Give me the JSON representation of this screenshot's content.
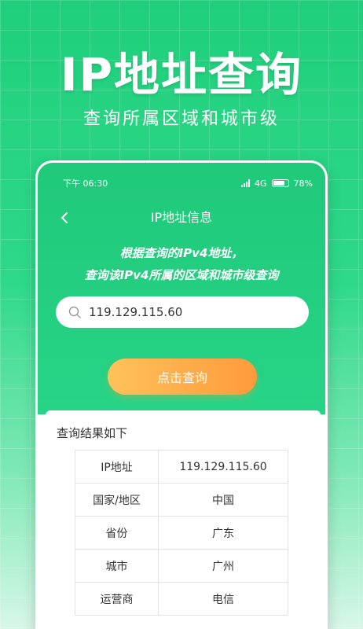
{
  "hero": {
    "title": "IP地址查询",
    "subtitle": "查询所属区域和城市级"
  },
  "status_bar": {
    "time": "下午 06:30",
    "network": "4G",
    "battery": "78%",
    "battery_level": 0.78
  },
  "nav": {
    "title": "IP地址信息"
  },
  "intro": {
    "line1": "根据查询的IPv4地址，",
    "line2": "查询该IPv4所属的区域和城市级查询"
  },
  "search": {
    "value": "119.129.115.60"
  },
  "query_button": {
    "label": "点击查询"
  },
  "result": {
    "title": "查询结果如下",
    "rows": [
      {
        "key": "IP地址",
        "value": "119.129.115.60"
      },
      {
        "key": "国家/地区",
        "value": "中国"
      },
      {
        "key": "省份",
        "value": "广东"
      },
      {
        "key": "城市",
        "value": "广州"
      },
      {
        "key": "运营商",
        "value": "电信"
      }
    ]
  },
  "colors": {
    "brand_green": "#20c97a",
    "button_orange": "#ff9a3c"
  },
  "icons": {
    "back": "chevron-left-icon",
    "search": "search-icon",
    "signal": "signal-icon",
    "battery": "battery-icon"
  }
}
